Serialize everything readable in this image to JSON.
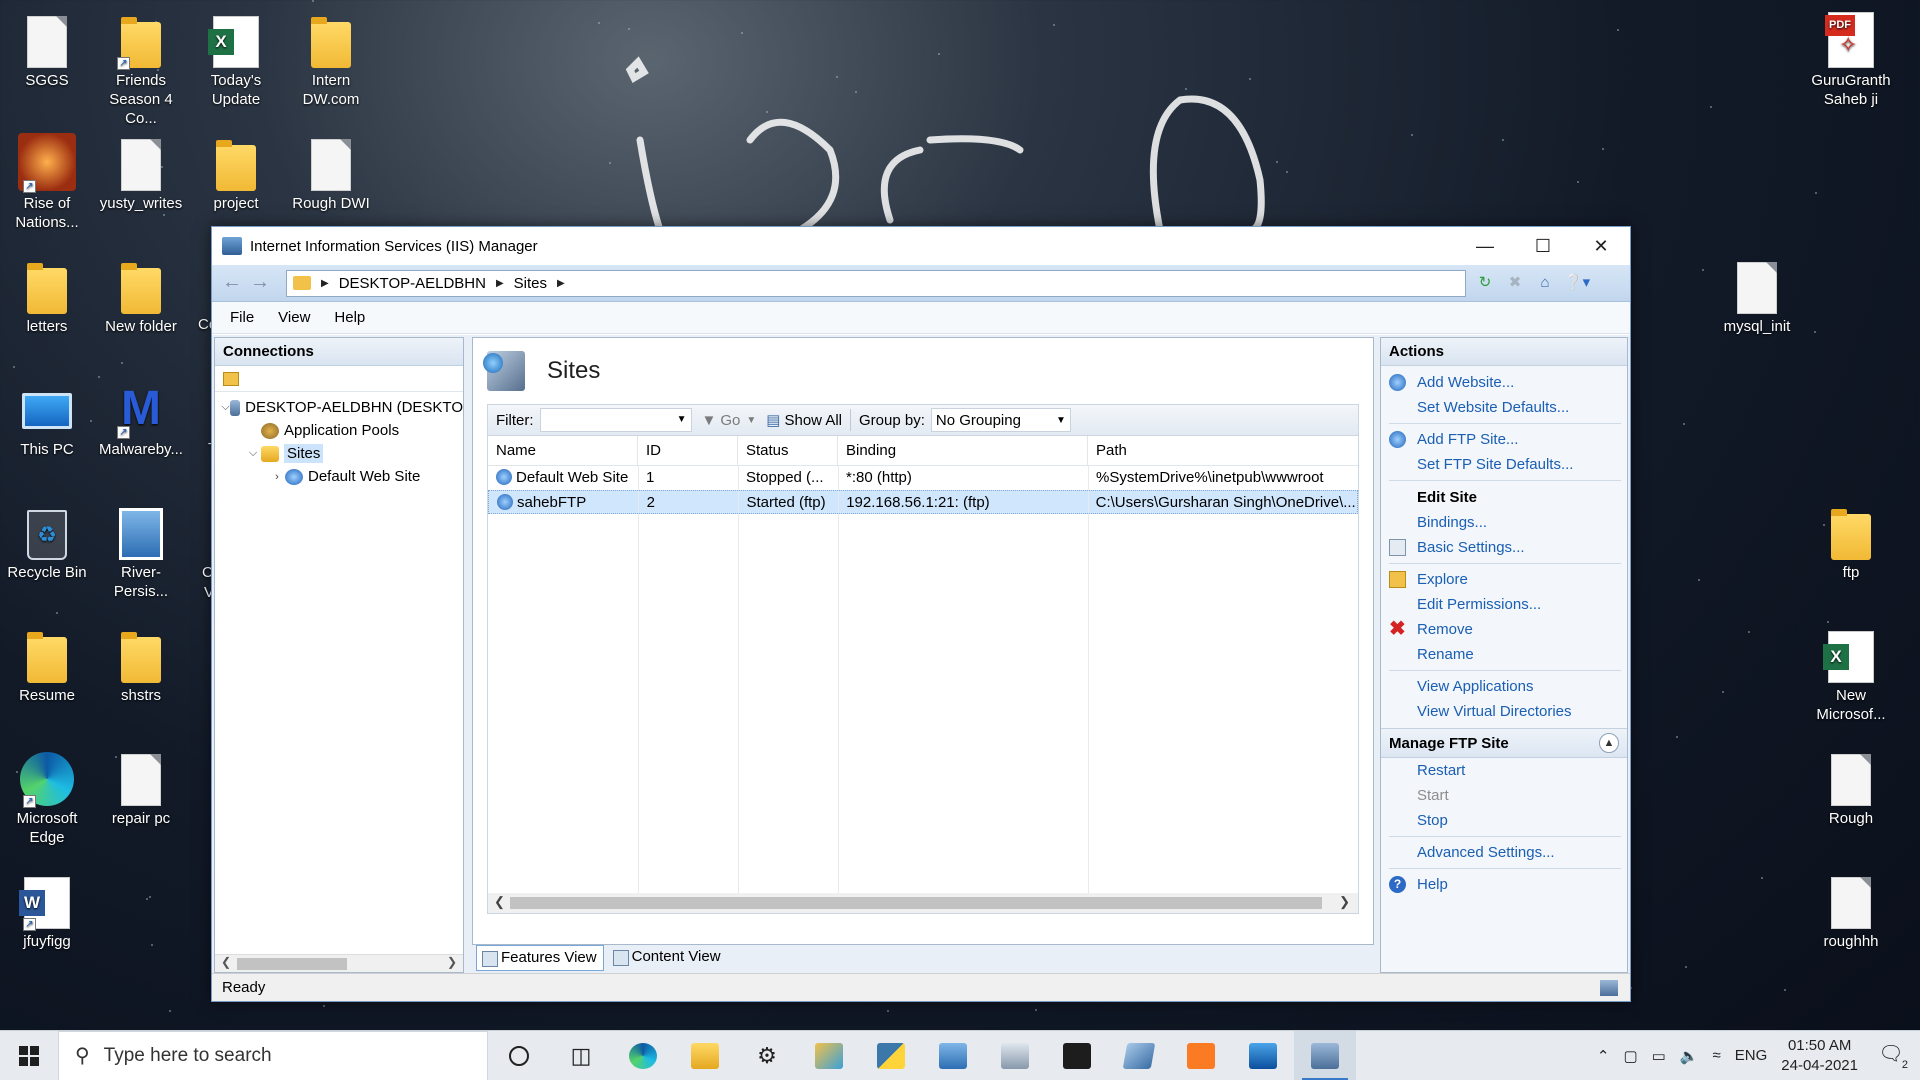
{
  "desktop": {
    "icons_left": [
      {
        "label": "SGGS",
        "type": "file"
      },
      {
        "label": "Friends Season 4 Co...",
        "type": "folder-shortcut"
      },
      {
        "label": "Today's Update",
        "type": "excel"
      },
      {
        "label": "Intern DW.com",
        "type": "folder"
      },
      {
        "label": "Rise of Nations...",
        "type": "game"
      },
      {
        "label": "yusty_writes",
        "type": "file"
      },
      {
        "label": "project",
        "type": "folder"
      },
      {
        "label": "Rough DWI",
        "type": "file"
      },
      {
        "label": "letters",
        "type": "folder"
      },
      {
        "label": "New folder",
        "type": "folder"
      },
      {
        "label": "This PC",
        "type": "pc"
      },
      {
        "label": "Malwareby...",
        "type": "malwarebytes"
      },
      {
        "label": "Recycle Bin",
        "type": "bin"
      },
      {
        "label": "River-Persis...",
        "type": "image"
      },
      {
        "label": "Resume",
        "type": "folder"
      },
      {
        "label": "shstrs",
        "type": "folder"
      },
      {
        "label": "Microsoft Edge",
        "type": "edge"
      },
      {
        "label": "repair pc",
        "type": "file"
      },
      {
        "label": "jfuyfigg",
        "type": "word"
      }
    ],
    "partial_labels": [
      "Co",
      "T",
      "C",
      "V"
    ],
    "icons_right": [
      {
        "label": "GuruGranth Saheb ji",
        "type": "pdf"
      },
      {
        "label": "mysql_init",
        "type": "file"
      },
      {
        "label": "ftp",
        "type": "folder"
      },
      {
        "label": "New Microsof...",
        "type": "excel"
      },
      {
        "label": "Rough",
        "type": "file"
      },
      {
        "label": "roughhh",
        "type": "file"
      }
    ]
  },
  "window": {
    "title": "Internet Information Services (IIS) Manager",
    "controls": {
      "minimize": "—",
      "maximize": "☐",
      "close": "✕"
    },
    "breadcrumb": [
      "DESKTOP-AELDBHN",
      "Sites"
    ],
    "menu": [
      "File",
      "View",
      "Help"
    ]
  },
  "connections": {
    "header": "Connections",
    "tree": [
      {
        "label": "DESKTOP-AELDBHN (DESKTO",
        "level": 0,
        "expander": "⌵",
        "icon": "server-icon"
      },
      {
        "label": "Application Pools",
        "level": 1,
        "expander": "",
        "icon": "app-pool-icon"
      },
      {
        "label": "Sites",
        "level": 1,
        "expander": "⌵",
        "icon": "sites-folder-icon",
        "selected": true
      },
      {
        "label": "Default Web Site",
        "level": 2,
        "expander": "›",
        "icon": "globe-icon"
      }
    ]
  },
  "main": {
    "title": "Sites",
    "filter_label": "Filter:",
    "go_label": "Go",
    "show_all_label": "Show All",
    "group_by_label": "Group by:",
    "group_by_value": "No Grouping",
    "columns": [
      "Name",
      "ID",
      "Status",
      "Binding",
      "Path"
    ],
    "rows": [
      {
        "name": "Default Web Site",
        "id": "1",
        "status": "Stopped (...",
        "binding": "*:80 (http)",
        "path": "%SystemDrive%\\inetpub\\wwwroot",
        "selected": false
      },
      {
        "name": "sahebFTP",
        "id": "2",
        "status": "Started (ftp)",
        "binding": "192.168.56.1:21: (ftp)",
        "path": "C:\\Users\\Gursharan Singh\\OneDrive\\...",
        "selected": true
      }
    ],
    "tabs": [
      "Features View",
      "Content View"
    ]
  },
  "actions": {
    "header": "Actions",
    "group1": [
      {
        "label": "Add Website...",
        "icon": "globe-icon"
      },
      {
        "label": "Set Website Defaults...",
        "icon": ""
      }
    ],
    "group2": [
      {
        "label": "Add FTP Site...",
        "icon": "globe-icon"
      },
      {
        "label": "Set FTP Site Defaults...",
        "icon": ""
      }
    ],
    "edit_site_title": "Edit Site",
    "group3": [
      {
        "label": "Bindings...",
        "icon": ""
      },
      {
        "label": "Basic Settings...",
        "icon": "doc-icon"
      }
    ],
    "group4": [
      {
        "label": "Explore",
        "icon": "folder-icon"
      },
      {
        "label": "Edit Permissions...",
        "icon": ""
      },
      {
        "label": "Remove",
        "icon": "remove-icon"
      },
      {
        "label": "Rename",
        "icon": ""
      }
    ],
    "group5": [
      {
        "label": "View Applications",
        "icon": ""
      },
      {
        "label": "View Virtual Directories",
        "icon": ""
      }
    ],
    "manage_title": "Manage FTP Site",
    "manage": [
      {
        "label": "Restart",
        "enabled": true
      },
      {
        "label": "Start",
        "enabled": false
      },
      {
        "label": "Stop",
        "enabled": true
      }
    ],
    "advanced": "Advanced Settings...",
    "help": "Help"
  },
  "status": "Ready",
  "taskbar": {
    "search_placeholder": "Type here to search",
    "language": "ENG",
    "time": "01:50 AM",
    "date": "24-04-2021",
    "notification_count": "2"
  }
}
